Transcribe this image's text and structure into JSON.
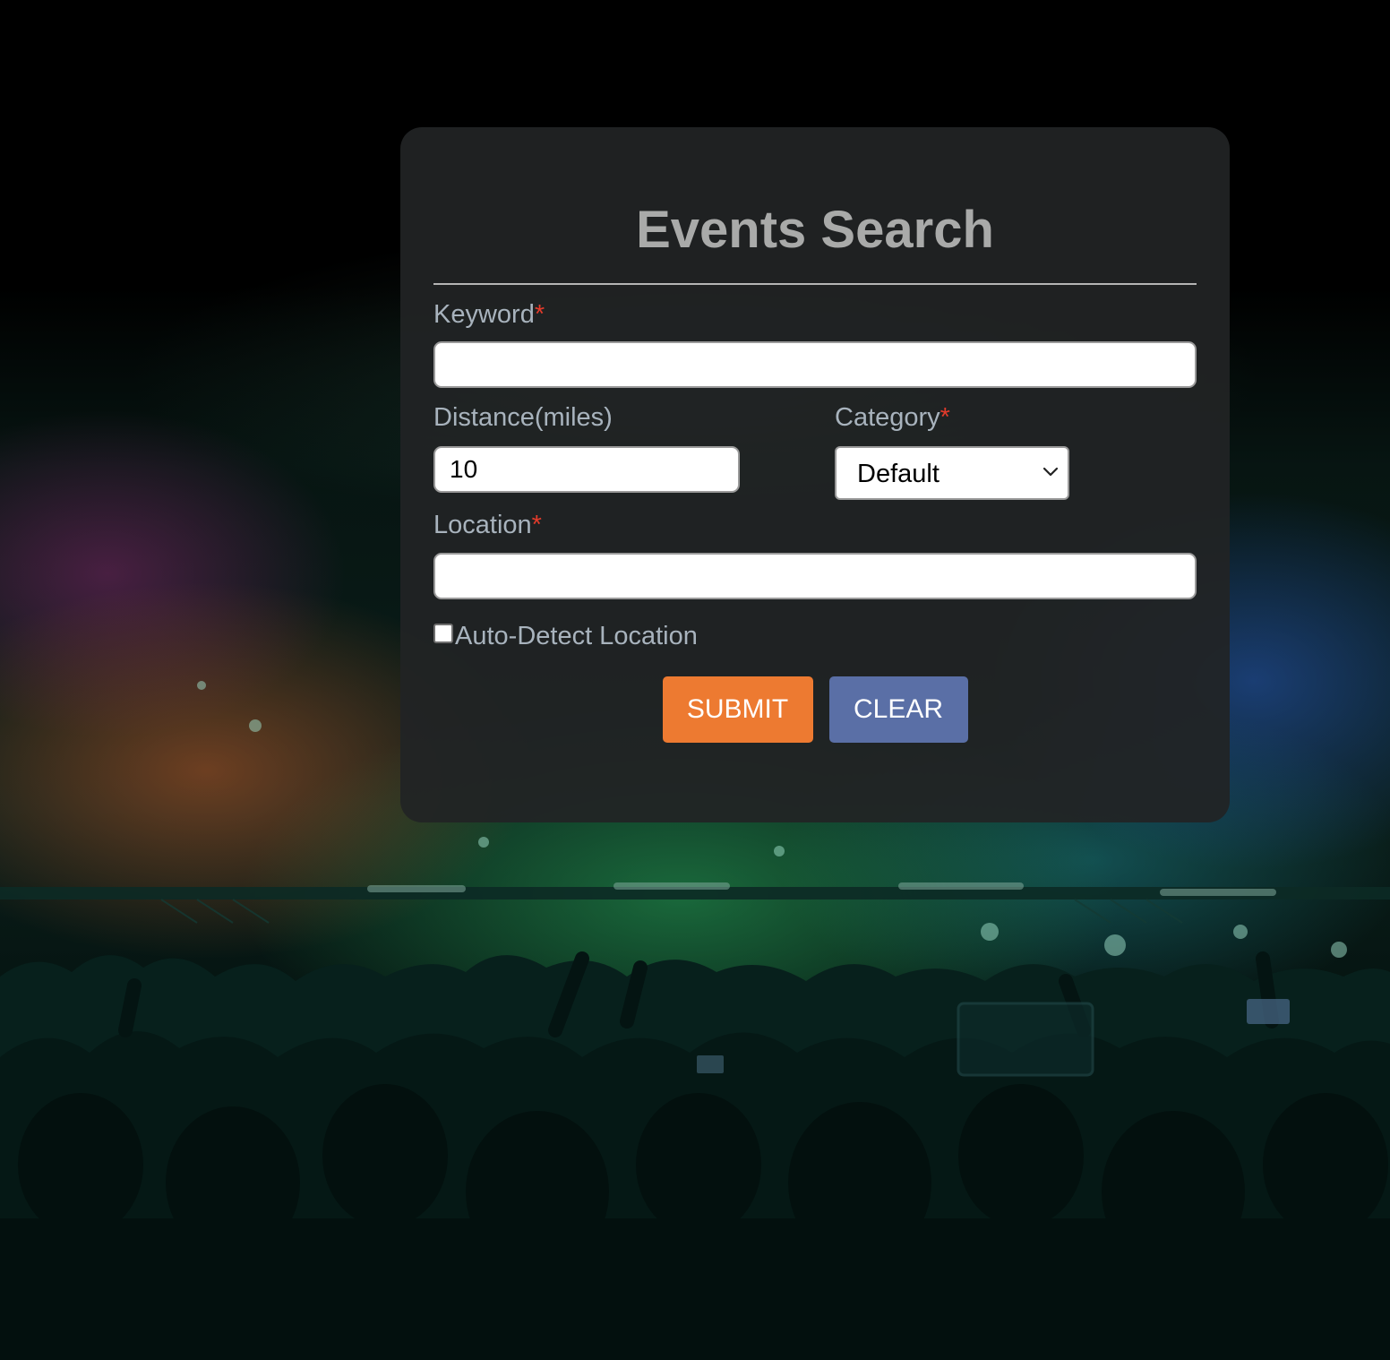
{
  "form": {
    "title": "Events Search",
    "keyword": {
      "label": "Keyword",
      "required_mark": "*",
      "value": ""
    },
    "distance": {
      "label": "Distance(miles)",
      "value": "10"
    },
    "category": {
      "label": "Category",
      "required_mark": "*",
      "selected": "Default"
    },
    "location": {
      "label": "Location",
      "required_mark": "*",
      "value": ""
    },
    "auto_detect": {
      "label": "Auto-Detect Location",
      "checked": false
    },
    "submit_label": "SUBMIT",
    "clear_label": "CLEAR"
  },
  "colors": {
    "required": "#e23b2b",
    "submit": "#ed7a31",
    "clear": "#5a6fa6",
    "panel": "#212425"
  },
  "icons": {
    "select_arrow": "chevron-down-icon"
  }
}
